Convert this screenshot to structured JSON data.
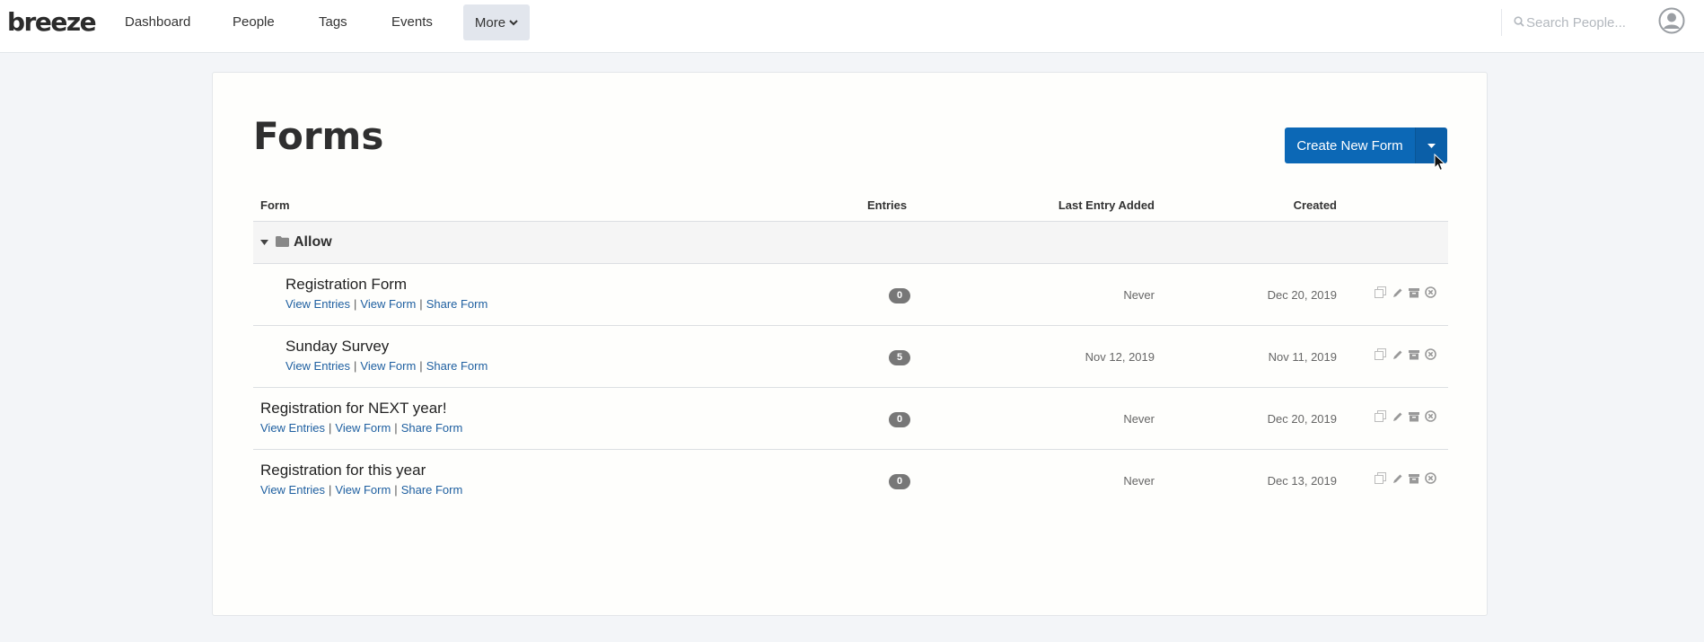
{
  "nav": {
    "logo": "breeze",
    "items": [
      {
        "label": "Dashboard"
      },
      {
        "label": "People"
      },
      {
        "label": "Tags"
      },
      {
        "label": "Events"
      }
    ],
    "more_label": "More",
    "search_placeholder": "Search People..."
  },
  "page": {
    "title": "Forms",
    "create_button": "Create New Form"
  },
  "table": {
    "headers": {
      "form": "Form",
      "entries": "Entries",
      "last_entry": "Last Entry Added",
      "created": "Created"
    },
    "folder": {
      "name": "Allow"
    },
    "link_labels": {
      "view_entries": "View Entries",
      "view_form": "View Form",
      "share_form": "Share Form"
    },
    "rows": [
      {
        "name": "Registration Form",
        "entries": "0",
        "last_entry": "Never",
        "created": "Dec 20, 2019"
      },
      {
        "name": "Sunday Survey",
        "entries": "5",
        "last_entry": "Nov 12, 2019",
        "created": "Nov 11, 2019"
      },
      {
        "name": "Registration for NEXT year!",
        "entries": "0",
        "last_entry": "Never",
        "created": "Dec 20, 2019"
      },
      {
        "name": "Registration for this year",
        "entries": "0",
        "last_entry": "Never",
        "created": "Dec 13, 2019"
      }
    ]
  },
  "icons": {
    "search": "search-icon",
    "avatar": "user-avatar-icon",
    "folder": "folder-icon",
    "caret": "caret-down-icon",
    "copy": "copy-icon",
    "edit": "pencil-icon",
    "archive": "archive-icon",
    "delete": "delete-circle-icon"
  },
  "colors": {
    "primary": "#0c68b6",
    "link": "#1e5fa0",
    "badge": "#777777",
    "background": "#f3f5f8"
  }
}
